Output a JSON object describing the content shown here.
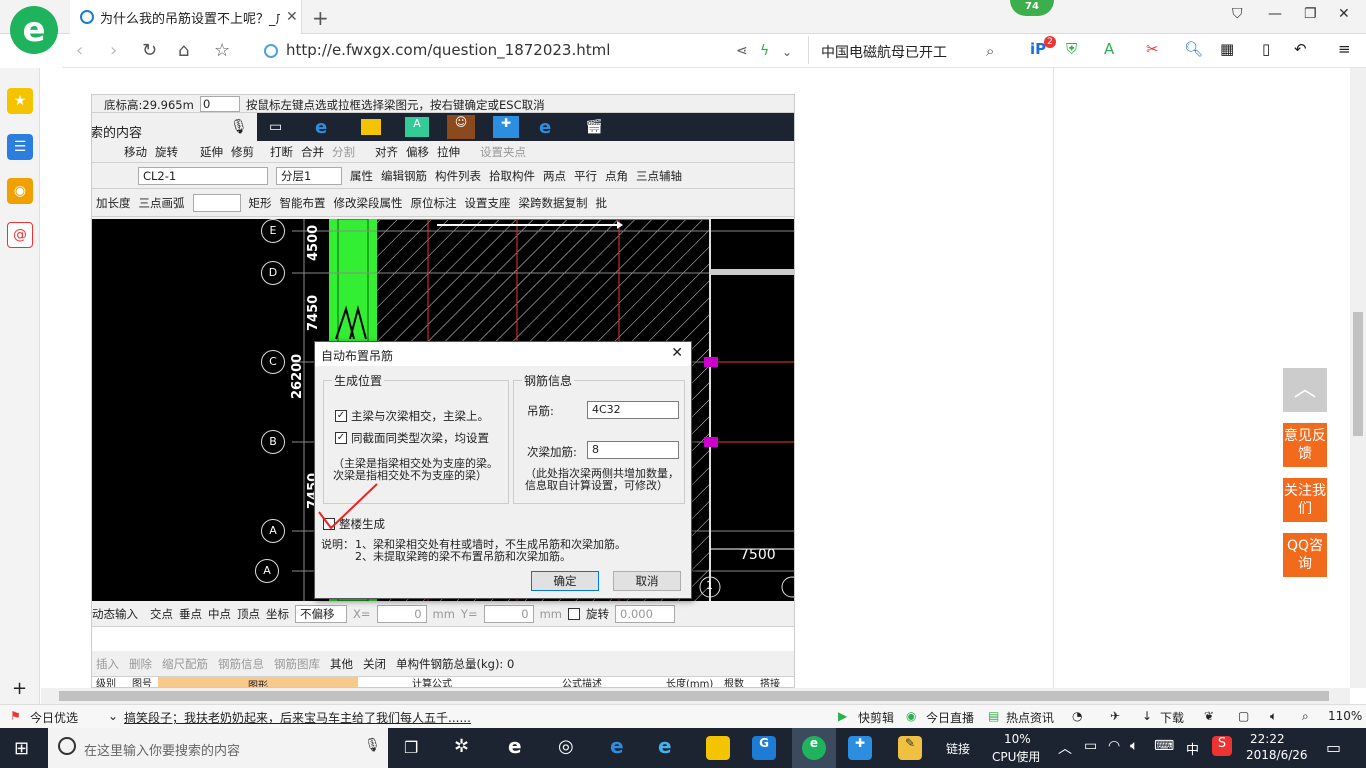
{
  "browser": {
    "tab_title": "为什么我的吊筋设置不上呢？_广",
    "tab_close": "✕",
    "new_tab": "+",
    "badge_count": "74",
    "url": "http://e.fwxgx.com/question_1872023.html",
    "search_text": "中国电磁航母已开工",
    "ext_badge": "2"
  },
  "cad_app": {
    "status_line": {
      "elev": "底标高:29.965m",
      "num": "0",
      "hint": "按鼠标左键点选或拉框选择梁图元，按右键确定或ESC取消"
    },
    "search_fragment": "索的内容",
    "toolbar1": [
      "移动",
      "旋转",
      "延伸",
      "修剪",
      "打断",
      "合并",
      "分割",
      "对齐",
      "偏移",
      "拉伸",
      "设置夹点"
    ],
    "toolbar2": {
      "select1": "CL2-1",
      "select2": "分层1",
      "items": [
        "属性",
        "编辑钢筋",
        "构件列表",
        "拾取构件",
        "两点",
        "平行",
        "点角",
        "三点辅轴"
      ]
    },
    "toolbar3": [
      "加长度",
      "三点画弧",
      "矩形",
      "智能布置",
      "修改梁段属性",
      "原位标注",
      "设置支座",
      "梁跨数据复制",
      "批"
    ],
    "axes": [
      "E",
      "D",
      "C",
      "B",
      "A",
      "A"
    ],
    "dims": [
      "4500",
      "7450",
      "26200",
      "7450"
    ],
    "right_dim": "7500",
    "bottom_axis": "1",
    "snapbar": {
      "dyn": "动态输入",
      "items": [
        "交点",
        "垂点",
        "中点",
        "顶点",
        "坐标"
      ],
      "offset": "不偏移",
      "x_label": "X=",
      "x_val": "0",
      "mm1": "mm",
      "y_label": "Y=",
      "y_val": "0",
      "mm2": "mm",
      "rotate": "旋转",
      "rot_val": "0.000"
    },
    "rebarbar": {
      "items": [
        "插入",
        "删除",
        "缩尺配筋",
        "钢筋信息",
        "钢筋图库",
        "其他",
        "关闭"
      ],
      "total": "单构件钢筋总量(kg): 0"
    },
    "table_head": [
      "级别",
      "图号",
      "图形",
      "计算公式",
      "公式描述",
      "长度(mm)",
      "根数",
      "搭接"
    ]
  },
  "dialog": {
    "title": "自动布置吊筋",
    "close": "✕",
    "group1": "生成位置",
    "check1": "主梁与次梁相交，主梁上。",
    "check2": "同截面同类型次梁，均设置",
    "note1": "（主梁是指梁相交处为支座的梁。次梁是指相交处不为支座的梁）",
    "group2": "钢筋信息",
    "hanger_label": "吊筋:",
    "hanger_value": "4C32",
    "extra_label": "次梁加筋:",
    "extra_value": "8",
    "note2": "（此处指次梁两侧共增加数量，信息取自计算设置，可修改）",
    "check3": "整楼生成",
    "desc_label": "说明：",
    "desc1": "1、梁和梁相交处有柱或墙时，不生成吊筋和次梁加筋。",
    "desc2": "2、未提取梁跨的梁不布置吊筋和次梁加筋。",
    "ok": "确定",
    "cancel": "取消"
  },
  "float_buttons": [
    "意见反馈",
    "关注我们",
    "QQ咨询"
  ],
  "status_bar": {
    "left_label": "今日优选",
    "news": "搞笑段子；我扶老奶奶起来，后来宝马车主给了我们每人五千......",
    "items": [
      "快剪辑",
      "今日直播",
      "热点资讯"
    ],
    "download": "下载",
    "zoom": "110%"
  },
  "taskbar": {
    "search_placeholder": "在这里输入你要搜索的内容",
    "link": "链接",
    "cpu_pct": "10%",
    "cpu_label": "CPU使用",
    "ime": "中",
    "time": "22:22",
    "date": "2018/6/26"
  }
}
